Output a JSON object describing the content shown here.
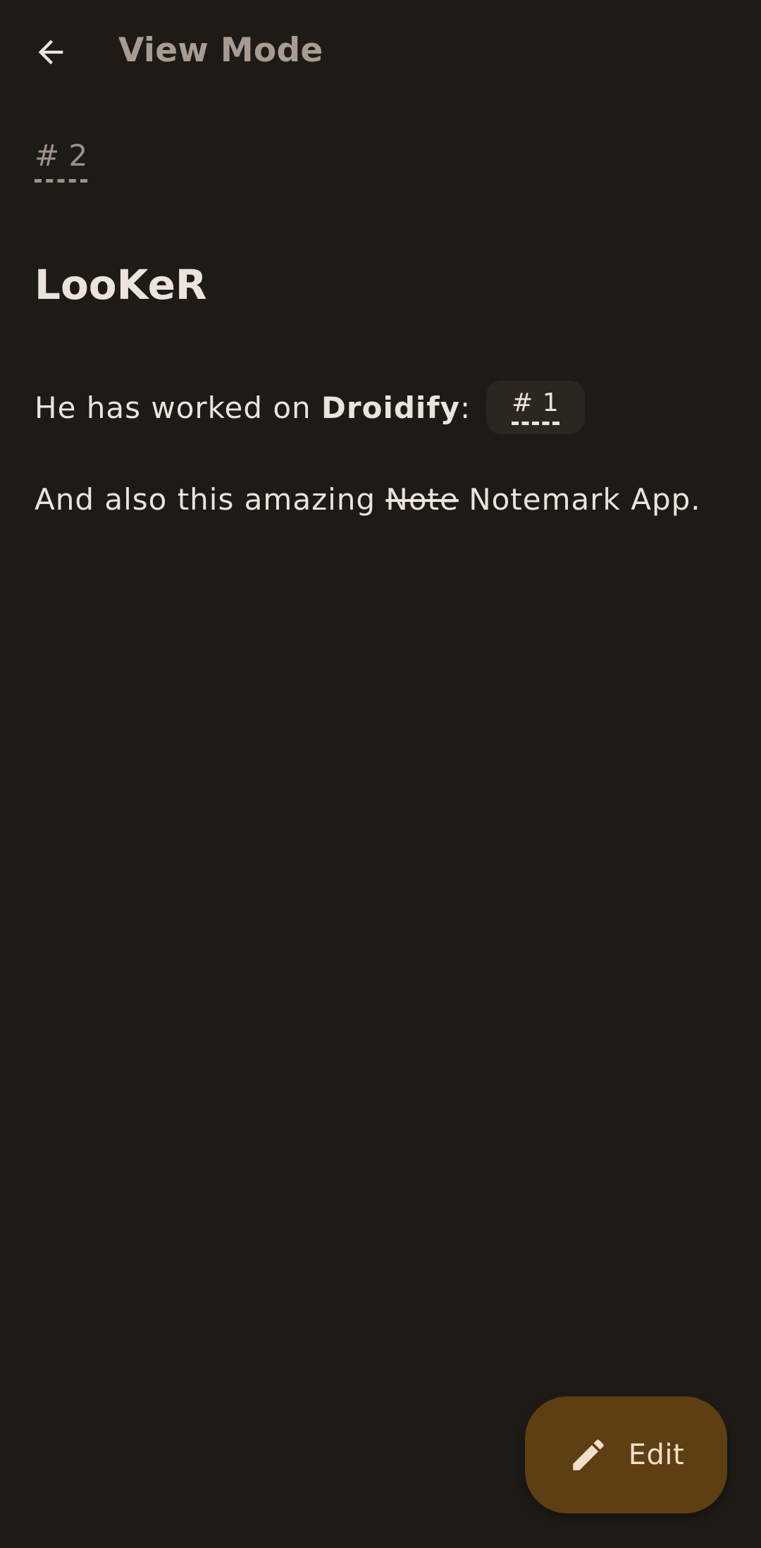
{
  "app_bar": {
    "title": "View Mode",
    "back_icon": "arrow-back-icon"
  },
  "note": {
    "tag": "# 2",
    "heading": "LooKeR",
    "line1": {
      "prefix": "He has worked on ",
      "bold": "Droidify",
      "suffix": ":",
      "tag_link": "# 1"
    },
    "line2": {
      "prefix": "And also this amazing ",
      "strikethrough": "Note",
      "suffix": " Notemark App."
    }
  },
  "fab": {
    "label": "Edit",
    "icon": "pencil-icon"
  },
  "colors": {
    "background": "#1e1b17",
    "text": "#ece3dc",
    "muted": "#a89c91",
    "fab_bg": "#5e3f13",
    "fab_fg": "#f1dfcb",
    "chip_bg": "#2c2621"
  }
}
